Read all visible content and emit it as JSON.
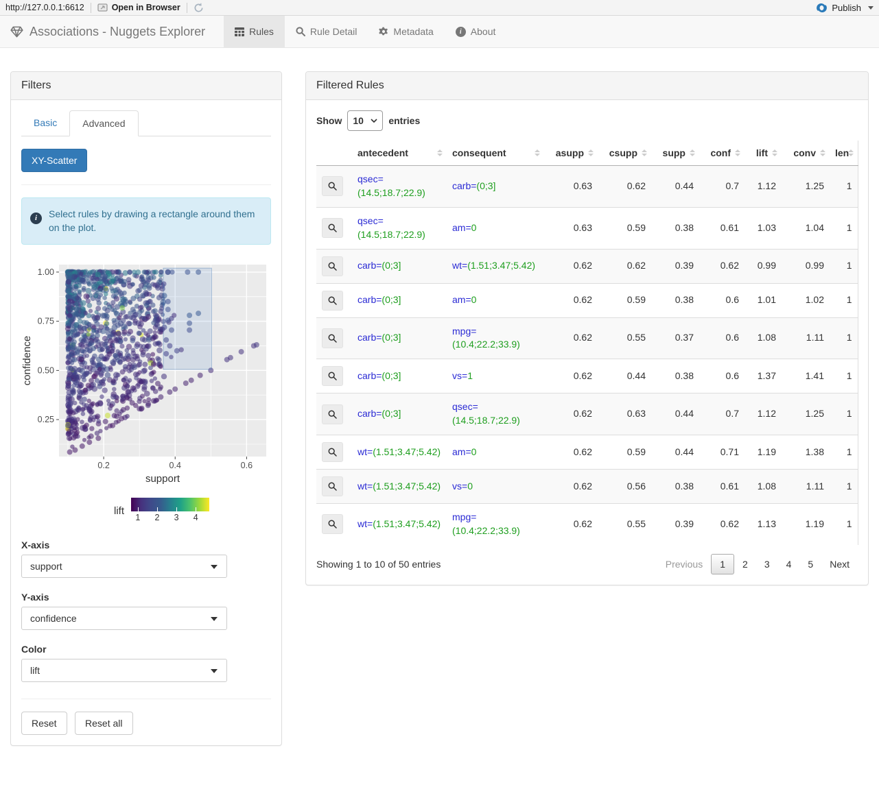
{
  "toolbar": {
    "url": "http://127.0.0.1:6612",
    "open_in_browser": "Open in Browser",
    "publish_label": "Publish"
  },
  "navbar": {
    "brand": "Associations - Nuggets Explorer",
    "tabs": [
      {
        "label": "Rules",
        "icon": "table-icon",
        "active": true
      },
      {
        "label": "Rule Detail",
        "icon": "search-icon",
        "active": false
      },
      {
        "label": "Metadata",
        "icon": "gear-icon",
        "active": false
      },
      {
        "label": "About",
        "icon": "info-icon",
        "active": false
      }
    ]
  },
  "filters": {
    "title": "Filters",
    "tabs": {
      "basic": "Basic",
      "advanced": "Advanced"
    },
    "scatter_button": "XY-Scatter",
    "alert_text": "Select rules by drawing a rectangle around them on the plot.",
    "controls": {
      "x_label": "X-axis",
      "x_value": "support",
      "y_label": "Y-axis",
      "y_value": "confidence",
      "color_label": "Color",
      "color_value": "lift"
    },
    "reset_label": "Reset",
    "reset_all_label": "Reset all"
  },
  "plot": {
    "type": "scatter",
    "xlabel": "support",
    "ylabel": "confidence",
    "x_range": [
      0.075,
      0.655
    ],
    "y_range": [
      0.062,
      1.038
    ],
    "x_ticks": [
      0.2,
      0.4,
      0.6
    ],
    "y_ticks": [
      0.25,
      0.5,
      0.75,
      1.0
    ],
    "x_tick_labels": [
      "0.2",
      "0.4",
      "0.6"
    ],
    "y_tick_labels": [
      "0.25",
      "0.50",
      "0.75",
      "1.00"
    ],
    "x_minor": [
      0.1,
      0.3,
      0.5
    ],
    "y_minor": [
      0.125,
      0.375,
      0.625,
      0.875
    ],
    "panel_color": "#ebebeb",
    "grid_color": "#ffffff",
    "legend": {
      "label": "lift",
      "domain": [
        0.65,
        4.7
      ],
      "ticks": [
        "1",
        "2",
        "3",
        "4"
      ],
      "tick_values": [
        1,
        2,
        3,
        4
      ]
    },
    "brush": {
      "x0": 0.367,
      "x1": 0.502,
      "y0": 0.505,
      "y1": 1.02
    },
    "seed": 42,
    "cluster": {
      "n": 950,
      "s_min": 0.1,
      "s_span": 0.27,
      "s_pow": 1.9,
      "c_pow": 0.8
    },
    "top_edge": {
      "n": 70,
      "c": 1.0,
      "s_span": 0.3
    },
    "band": {
      "n": 55,
      "c_min": 0.95
    },
    "streaks": [
      {
        "k": 1.0,
        "n": 18,
        "s_max": 0.35
      },
      {
        "k": 1.45,
        "n": 24,
        "s_max": 0.42
      },
      {
        "k": 1.95,
        "n": 22,
        "s_max": 0.4
      },
      {
        "k": 2.7,
        "n": 18,
        "s_max": 0.35
      }
    ],
    "outliers": [
      [
        0.38,
        1.0,
        1.9
      ],
      [
        0.435,
        1.0,
        1.8
      ],
      [
        0.465,
        1.0,
        1.9
      ],
      [
        0.325,
        0.96,
        1.6
      ],
      [
        0.305,
        0.93,
        1.4
      ],
      [
        0.35,
        0.935,
        1.5
      ],
      [
        0.33,
        0.85,
        1.5
      ],
      [
        0.355,
        0.87,
        1.6
      ],
      [
        0.36,
        0.8,
        1.5
      ],
      [
        0.32,
        0.89,
        1.4
      ],
      [
        0.38,
        0.85,
        1.7
      ],
      [
        0.38,
        0.81,
        1.7
      ],
      [
        0.44,
        0.78,
        2.0
      ],
      [
        0.465,
        0.79,
        2.0
      ],
      [
        0.38,
        0.755,
        1.7
      ],
      [
        0.345,
        0.755,
        1.5
      ],
      [
        0.39,
        0.705,
        1.6
      ],
      [
        0.44,
        0.74,
        1.8
      ],
      [
        0.44,
        0.705,
        1.6
      ],
      [
        0.33,
        0.7,
        1.4
      ],
      [
        0.36,
        0.71,
        1.5
      ],
      [
        0.375,
        0.655,
        1.4
      ],
      [
        0.345,
        0.635,
        1.3
      ],
      [
        0.385,
        0.625,
        1.3
      ],
      [
        0.375,
        0.585,
        1.3
      ],
      [
        0.405,
        0.6,
        1.4
      ],
      [
        0.325,
        0.575,
        1.2
      ],
      [
        0.5,
        0.5,
        1.1
      ],
      [
        0.545,
        0.555,
        1.2
      ],
      [
        0.555,
        0.565,
        1.2
      ],
      [
        0.585,
        0.595,
        1.2
      ],
      [
        0.62,
        0.625,
        1.2
      ],
      [
        0.628,
        0.63,
        1.3
      ],
      [
        0.47,
        0.475,
        1.0
      ],
      [
        0.445,
        0.45,
        1.0
      ],
      [
        0.43,
        0.435,
        1.0
      ],
      [
        0.4,
        0.405,
        1.0
      ],
      [
        0.385,
        0.39,
        1.0
      ],
      [
        0.36,
        0.365,
        1.0
      ],
      [
        0.34,
        0.345,
        1.0
      ],
      [
        0.325,
        0.33,
        1.0
      ],
      [
        0.3,
        0.305,
        1.0
      ],
      [
        0.31,
        0.58,
        1.3
      ],
      [
        0.3,
        0.53,
        1.2
      ],
      [
        0.315,
        0.5,
        1.2
      ],
      [
        0.29,
        0.48,
        1.15
      ],
      [
        0.31,
        0.445,
        1.1
      ],
      [
        0.295,
        0.42,
        1.1
      ],
      [
        0.28,
        0.335,
        0.95
      ],
      [
        0.255,
        0.3,
        0.95
      ],
      [
        0.23,
        0.27,
        0.95
      ],
      [
        0.205,
        0.24,
        0.95
      ],
      [
        0.225,
        0.22,
        0.9
      ],
      [
        0.25,
        0.255,
        0.9
      ],
      [
        0.185,
        0.155,
        0.9
      ],
      [
        0.16,
        0.135,
        0.9
      ],
      [
        0.14,
        0.115,
        0.9
      ],
      [
        0.12,
        0.095,
        0.9
      ],
      [
        0.105,
        0.085,
        0.9
      ]
    ]
  },
  "rules": {
    "title": "Filtered Rules",
    "show_label": "Show",
    "entries_label": "entries",
    "page_size": "10",
    "columns": [
      "antecedent",
      "consequent",
      "asupp",
      "csupp",
      "supp",
      "conf",
      "lift",
      "conv",
      "len"
    ],
    "rows": [
      {
        "antecedent": {
          "var": "qsec=",
          "val": "(14.5;18.7;22.9)"
        },
        "consequent": {
          "var": "carb=",
          "val": "(0;3]"
        },
        "asupp": "0.63",
        "csupp": "0.62",
        "supp": "0.44",
        "conf": "0.7",
        "lift": "1.12",
        "conv": "1.25",
        "len": "1"
      },
      {
        "antecedent": {
          "var": "qsec=",
          "val": "(14.5;18.7;22.9)"
        },
        "consequent": {
          "var": "am=",
          "val": "0"
        },
        "asupp": "0.63",
        "csupp": "0.59",
        "supp": "0.38",
        "conf": "0.61",
        "lift": "1.03",
        "conv": "1.04",
        "len": "1"
      },
      {
        "antecedent": {
          "var": "carb=",
          "val": "(0;3]"
        },
        "consequent": {
          "var": "wt=",
          "val": "(1.51;3.47;5.42)"
        },
        "asupp": "0.62",
        "csupp": "0.62",
        "supp": "0.39",
        "conf": "0.62",
        "lift": "0.99",
        "conv": "0.99",
        "len": "1"
      },
      {
        "antecedent": {
          "var": "carb=",
          "val": "(0;3]"
        },
        "consequent": {
          "var": "am=",
          "val": "0"
        },
        "asupp": "0.62",
        "csupp": "0.59",
        "supp": "0.38",
        "conf": "0.6",
        "lift": "1.01",
        "conv": "1.02",
        "len": "1"
      },
      {
        "antecedent": {
          "var": "carb=",
          "val": "(0;3]"
        },
        "consequent": {
          "var": "mpg=",
          "val": "(10.4;22.2;33.9)"
        },
        "asupp": "0.62",
        "csupp": "0.55",
        "supp": "0.37",
        "conf": "0.6",
        "lift": "1.08",
        "conv": "1.11",
        "len": "1"
      },
      {
        "antecedent": {
          "var": "carb=",
          "val": "(0;3]"
        },
        "consequent": {
          "var": "vs=",
          "val": "1"
        },
        "asupp": "0.62",
        "csupp": "0.44",
        "supp": "0.38",
        "conf": "0.6",
        "lift": "1.37",
        "conv": "1.41",
        "len": "1"
      },
      {
        "antecedent": {
          "var": "carb=",
          "val": "(0;3]"
        },
        "consequent": {
          "var": "qsec=",
          "val": "(14.5;18.7;22.9)"
        },
        "asupp": "0.62",
        "csupp": "0.63",
        "supp": "0.44",
        "conf": "0.7",
        "lift": "1.12",
        "conv": "1.25",
        "len": "1"
      },
      {
        "antecedent": {
          "var": "wt=",
          "val": "(1.51;3.47;5.42)"
        },
        "consequent": {
          "var": "am=",
          "val": "0"
        },
        "asupp": "0.62",
        "csupp": "0.59",
        "supp": "0.44",
        "conf": "0.71",
        "lift": "1.19",
        "conv": "1.38",
        "len": "1"
      },
      {
        "antecedent": {
          "var": "wt=",
          "val": "(1.51;3.47;5.42)"
        },
        "consequent": {
          "var": "vs=",
          "val": "0"
        },
        "asupp": "0.62",
        "csupp": "0.56",
        "supp": "0.38",
        "conf": "0.61",
        "lift": "1.08",
        "conv": "1.11",
        "len": "1"
      },
      {
        "antecedent": {
          "var": "wt=",
          "val": "(1.51;3.47;5.42)"
        },
        "consequent": {
          "var": "mpg=",
          "val": "(10.4;22.2;33.9)"
        },
        "asupp": "0.62",
        "csupp": "0.55",
        "supp": "0.39",
        "conf": "0.62",
        "lift": "1.13",
        "conv": "1.19",
        "len": "1"
      }
    ],
    "info": "Showing 1 to 10 of 50 entries",
    "pagination": {
      "previous": "Previous",
      "pages": [
        "1",
        "2",
        "3",
        "4",
        "5"
      ],
      "active": "1",
      "next": "Next"
    }
  },
  "colors": {
    "accent": "#337ab7",
    "antecedent_var": "#2a2ad4",
    "value_green": "#1e9e1e",
    "navbar_bg": "#f8f8f8",
    "publish_blue": "#2a7ab9"
  }
}
